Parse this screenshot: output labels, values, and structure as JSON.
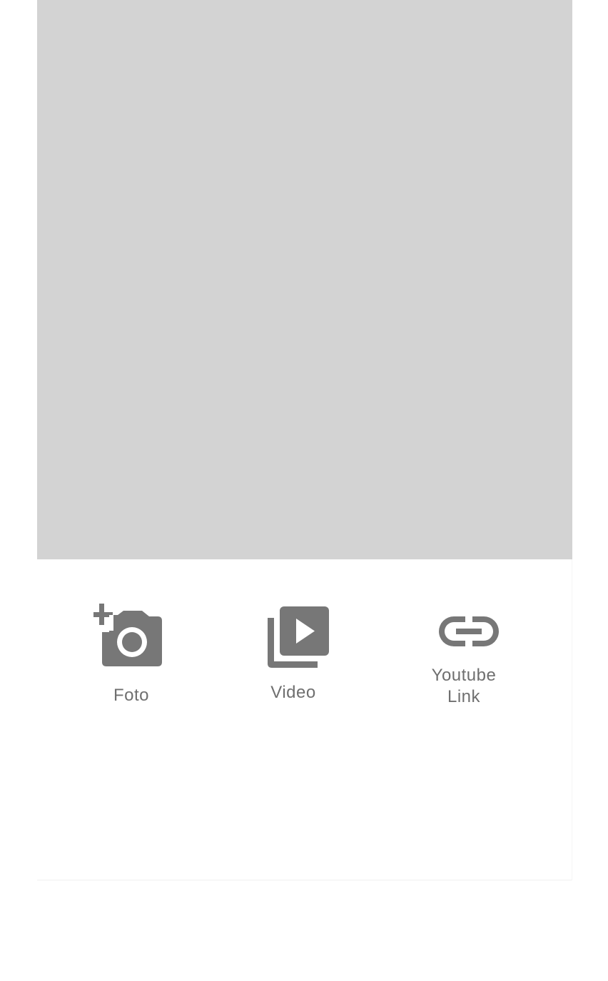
{
  "media_preview": {
    "background_color": "#d3d3d3"
  },
  "actions": {
    "foto": {
      "label": "Foto",
      "icon": "add-photo-camera-icon"
    },
    "video": {
      "label": "Video",
      "icon": "video-library-icon"
    },
    "youtube_link": {
      "label_line1": "Youtube",
      "label_line2": "Link",
      "icon": "link-icon"
    }
  },
  "colors": {
    "icon": "#777777",
    "label": "#6f6f6f"
  }
}
